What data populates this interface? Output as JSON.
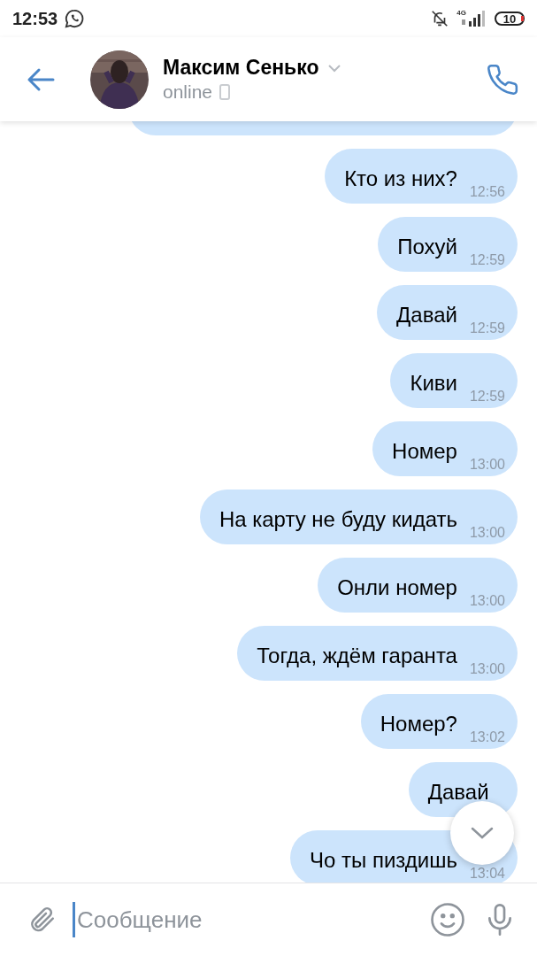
{
  "status_bar": {
    "time": "12:53",
    "network": "4G",
    "battery": "10"
  },
  "header": {
    "name": "Максим Сенько",
    "status": "online"
  },
  "messages": [
    {
      "text": "Кто из них?",
      "time": "12:56"
    },
    {
      "text": "Похуй",
      "time": "12:59"
    },
    {
      "text": "Давай",
      "time": "12:59"
    },
    {
      "text": "Киви",
      "time": "12:59"
    },
    {
      "text": "Номер",
      "time": "13:00"
    },
    {
      "text": "На карту не буду кидать",
      "time": "13:00"
    },
    {
      "text": "Онли номер",
      "time": "13:00"
    },
    {
      "text": "Тогда, ждём гаранта",
      "time": "13:00"
    },
    {
      "text": "Номер?",
      "time": "13:02"
    },
    {
      "text": "Давай"
    },
    {
      "text": "Чо ты пиздишь",
      "time": "13:04"
    }
  ],
  "composer": {
    "placeholder": "Сообщение"
  }
}
